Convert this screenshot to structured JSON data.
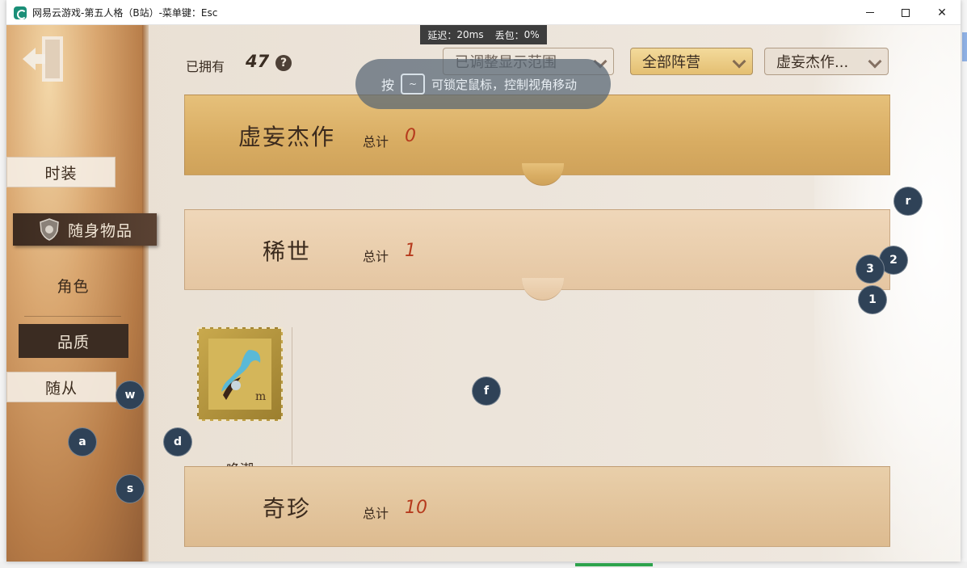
{
  "window": {
    "title": "网易云游戏-第五人格（B站）-菜单键：Esc"
  },
  "network": {
    "latency_label": "延迟：",
    "latency_value": "20ms",
    "loss_label": "丢包：",
    "loss_value": "0%"
  },
  "sidebar": {
    "items": [
      {
        "label": "时装"
      },
      {
        "label": "随身物品"
      },
      {
        "label": "角色"
      },
      {
        "label": "品质"
      },
      {
        "label": "随从"
      }
    ]
  },
  "header": {
    "owned_label": "已拥有",
    "owned_count": "47",
    "help": "?"
  },
  "filters": {
    "display_range": "已调整显示范围",
    "faction": "全部阵营",
    "rarity": "虚妄杰作..."
  },
  "hint": {
    "prefix": "按",
    "key": "~",
    "text": "可锁定鼠标，控制视角移动"
  },
  "categories": [
    {
      "title": "虚妄杰作",
      "total_label": "总计",
      "total": "0"
    },
    {
      "title": "稀世",
      "total_label": "总计",
      "total": "1"
    },
    {
      "title": "奇珍",
      "total_label": "总计",
      "total": "10"
    }
  ],
  "items": [
    {
      "name": "唤潮"
    }
  ],
  "key_badges": [
    "r",
    "2",
    "3",
    "1",
    "w",
    "f",
    "a",
    "d",
    "s"
  ],
  "colors": {
    "accent_gold": "#e4bf72",
    "total_red": "#b63a1d",
    "badge_bg": "#2f4257"
  }
}
